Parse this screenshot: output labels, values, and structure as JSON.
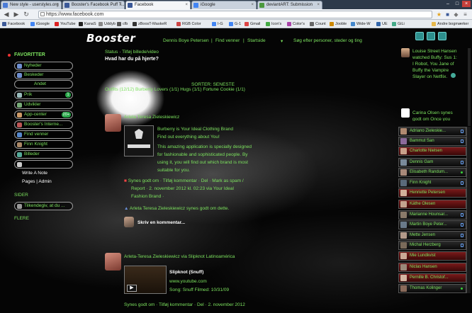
{
  "tabs": [
    {
      "title": "New style - userstyles.org",
      "active": false
    },
    {
      "title": "Booster's Facebook Puff T...",
      "active": false
    },
    {
      "title": "Facebook",
      "active": true
    },
    {
      "title": "iGoogle",
      "active": false
    },
    {
      "title": "deviantART: Submission",
      "active": false
    }
  ],
  "address": {
    "url": "https://www.facebook.com"
  },
  "bookmarks": [
    "Facebook",
    "iGoogle",
    "YouTube",
    "KanaS",
    "Uddyb",
    "cfb",
    "zBoosT-MaskeR",
    "RGB Color",
    "I-G",
    "G-1",
    "Gmail",
    "Icon's",
    "Color's",
    "Count",
    "Jooble",
    "Wide-W",
    "UE",
    "GiLi",
    "Andre bogmærker"
  ],
  "nav": {
    "logo": "Booster",
    "links": [
      "Dennis Boye Petersen",
      "Find venner",
      "Startside"
    ],
    "separators": [
      "|",
      "|"
    ],
    "search_placeholder": "Søg efter personer, steder og ting"
  },
  "sidebar": {
    "favorites_label": "FAVORITTER",
    "items": [
      {
        "label": "Nyheder",
        "count": ""
      },
      {
        "label": "Beskeder",
        "count": ""
      },
      {
        "label": "Andet",
        "count": ""
      },
      {
        "label": "Prik",
        "count": "1"
      },
      {
        "label": "Udvikler",
        "count": ""
      },
      {
        "label": "App-center",
        "count": "20+"
      },
      {
        "label": "Booster's Interne...",
        "count": ""
      },
      {
        "label": "Find venner",
        "count": ""
      },
      {
        "label": "Finn Knight",
        "count": ""
      },
      {
        "label": "Billeder",
        "count": ""
      }
    ],
    "plain": [
      "Write A Note",
      "Pages | Admin"
    ],
    "pages_label": "SIDER",
    "page_item": "Tilkendegiv, at du ...",
    "more_label": "FLERE"
  },
  "composer": {
    "status": "Status",
    "photo": "Tilføj billede/video",
    "prompt": "Hvad har du på hjerte?"
  },
  "feed": {
    "sort_label": "SORTER: SENESTE",
    "filters": "Outfits (12/12)  Burberry Lovers (1/1)  Hugs (1/1)  Fortune Cookie (1/1)",
    "post1": {
      "author": "Arleta Teresa Zieleskiewicz",
      "lines": [
        "Burberry is Your Ideal Clothing Brand",
        "Find out everything about You!",
        "This amazing application is specially designed",
        "for fashionable and sophisticated people. By",
        "using it, you will find out which brand is most",
        "suitable for you."
      ],
      "actions": "Synes godt om · Tilføj kommentar · Del · Mark as spam /",
      "actions2": "Report · 2. november 2012 kl. 02:23 via Your Ideal",
      "actions3": "Fashion Brand ·",
      "likes": "Arleta Teresa Zieleskiewicz synes godt om dette.",
      "comment_placeholder": "Skriv en kommentar..."
    },
    "post2": {
      "author": "Arleta-Teresa Zieleskiewicz via Slipknot Latinoamérica",
      "title": "Slipknot (Snuff)",
      "site": "www.youtube.com",
      "desc": "Song: Snuff Filmed: 10/31/09",
      "actions": "Synes godt om · Tilføj kommentar · Del · 2. november 2012"
    }
  },
  "ticker": [
    {
      "text": "Louise Street Hansen watched Buffy: Sus 1: I Robot, You Jane of Buffy the Vampire Slayer on Netflix."
    },
    {
      "text": "Carina Olsen synes godt om Once you"
    }
  ],
  "chat": [
    {
      "name": "Adriano Zieleskie...",
      "online": false
    },
    {
      "name": "Bammut San",
      "online": false
    },
    {
      "name": "Charlotte Nielsen",
      "online": false
    },
    {
      "name": "Dennis Gam",
      "online": false
    },
    {
      "name": "Elisabeth Randum...",
      "online": true
    },
    {
      "name": "Finn Knight",
      "online": false
    },
    {
      "name": "Henriette Petersen",
      "online": false
    },
    {
      "name": "Käthe Olesen",
      "online": false
    },
    {
      "name": "Marianne Hounsar...",
      "online": false
    },
    {
      "name": "Martin Boye Peter...",
      "online": false
    },
    {
      "name": "Mette Jensen",
      "online": false
    },
    {
      "name": "Michal Herzberg",
      "online": false
    },
    {
      "name": "Mie Lundkvist",
      "online": false
    },
    {
      "name": "Niclas Hansen",
      "online": false
    },
    {
      "name": "Pernille B. Christof...",
      "online": false
    },
    {
      "name": "Thomas Kolinger",
      "online": true
    }
  ],
  "colors": {
    "accent": "#7ce25e",
    "highlight_row": "#6a0f0f"
  }
}
